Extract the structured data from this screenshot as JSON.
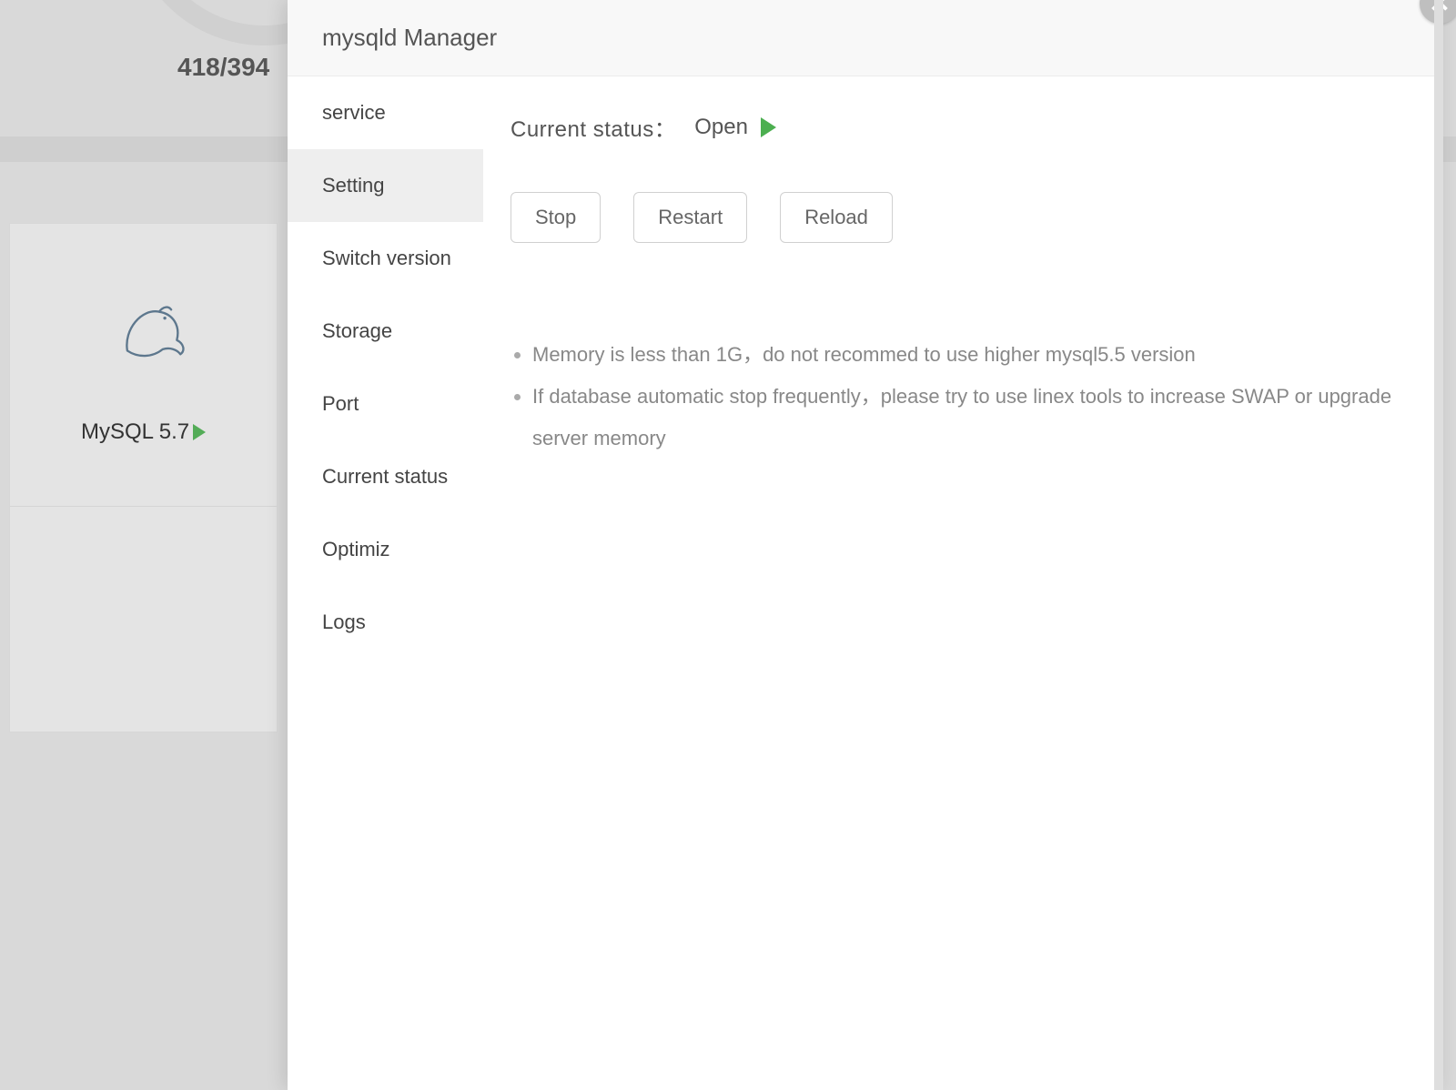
{
  "background": {
    "counter": "418/394",
    "mysql_label": "MySQL 5.7"
  },
  "modal": {
    "title": "mysqld Manager",
    "sidebar": {
      "items": [
        {
          "label": "service"
        },
        {
          "label": "Setting"
        },
        {
          "label": "Switch version"
        },
        {
          "label": "Storage"
        },
        {
          "label": "Port"
        },
        {
          "label": "Current status"
        },
        {
          "label": "Optimiz"
        },
        {
          "label": "Logs"
        }
      ],
      "active_index": 1
    },
    "content": {
      "status_label": "Current status：",
      "status_value": "Open",
      "buttons": {
        "stop": "Stop",
        "restart": "Restart",
        "reload": "Reload"
      },
      "notes": [
        "Memory is less than 1G，do not recommed to use higher mysql5.5 version",
        "If database automatic stop frequently，please try to use linex tools to increase SWAP or upgrade server memory"
      ]
    }
  }
}
